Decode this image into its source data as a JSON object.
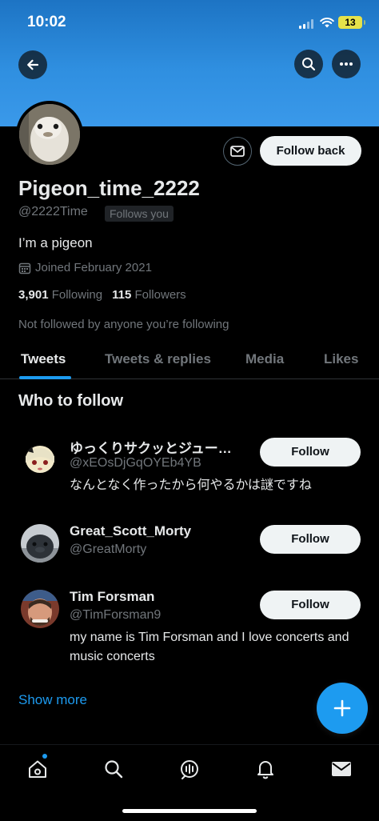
{
  "status_bar": {
    "time": "10:02",
    "battery": "13"
  },
  "profile": {
    "name": "Pigeon_time_2222",
    "handle": "@2222Time",
    "follows_you": "Follows you",
    "bio": "I’m a pigeon",
    "joined": "Joined February 2021",
    "following_count": "3,901",
    "following_label": "Following",
    "followers_count": "115",
    "followers_label": "Followers",
    "not_followed": "Not followed by anyone you’re following",
    "follow_back_label": "Follow back"
  },
  "tabs": [
    {
      "label": "Tweets",
      "active": true
    },
    {
      "label": "Tweets & replies",
      "active": false
    },
    {
      "label": "Media",
      "active": false
    },
    {
      "label": "Likes",
      "active": false
    }
  ],
  "who_to_follow": {
    "title": "Who to follow",
    "follow_label": "Follow",
    "items": [
      {
        "name": "ゆっくりサクッとジュー…",
        "handle": "@xEOsDjGqOYEb4YB",
        "bio": "なんとなく作ったから何やるかは謎ですね"
      },
      {
        "name": "Great_Scott_Morty",
        "handle": "@GreatMorty",
        "bio": ""
      },
      {
        "name": "Tim Forsman",
        "handle": "@TimForsman9",
        "bio": "my name is Tim Forsman and I love concerts and music concerts"
      }
    ],
    "show_more": "Show more"
  },
  "colors": {
    "accent": "#1d9bf0",
    "background": "#000000",
    "banner": "#2f8fe0",
    "muted": "#71767b"
  },
  "icons": [
    "back-arrow-icon",
    "search-icon",
    "more-icon",
    "mail-icon",
    "calendar-icon",
    "plus-icon",
    "home-icon",
    "spaces-icon",
    "bell-icon",
    "envelope-icon"
  ]
}
